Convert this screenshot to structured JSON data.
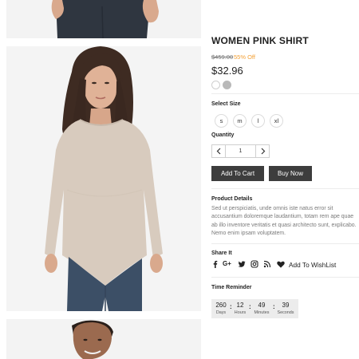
{
  "product": {
    "title": "WOMEN PINK SHIRT",
    "old_price": "$459.00",
    "discount": "55% Off",
    "price": "$32.96",
    "colors": [
      "#ffffff",
      "#b9b9b9"
    ]
  },
  "size": {
    "label": "Select Size",
    "options": [
      "s",
      "m",
      "l",
      "xl"
    ]
  },
  "quantity": {
    "label": "Quantity",
    "value": "1",
    "minus_icon": "chevron-left-icon",
    "plus_icon": "chevron-right-icon"
  },
  "actions": {
    "add_to_cart": "Add To Cart",
    "buy_now": "Buy Now"
  },
  "details": {
    "label": "Product Details",
    "text": "Sed ut perspiciatis, unde omnis iste natus error sit accusantium doloremque laudantium, totam rem ape quae ab illo inventore veritatis et quasi architecto sunt, explicabo. Nemo enim ipsam voluptatem."
  },
  "share": {
    "label": "Share It",
    "icons": [
      "facebook-icon",
      "google-plus-icon",
      "twitter-icon",
      "instagram-icon",
      "rss-icon"
    ],
    "gplus_text": "G+",
    "wishlist": "Add To WishList",
    "wishlist_icon": "heart-icon"
  },
  "timer": {
    "label": "Time Reminder",
    "days": "260",
    "days_label": "Days",
    "hours": "12",
    "hours_label": "Hours",
    "minutes": "49",
    "minutes_label": "Minutes",
    "seconds": "39",
    "seconds_label": "Seconds",
    "separator": ":"
  },
  "accent_colors": {
    "discount": "#f4a136",
    "button_bg": "#3d3d3d"
  }
}
